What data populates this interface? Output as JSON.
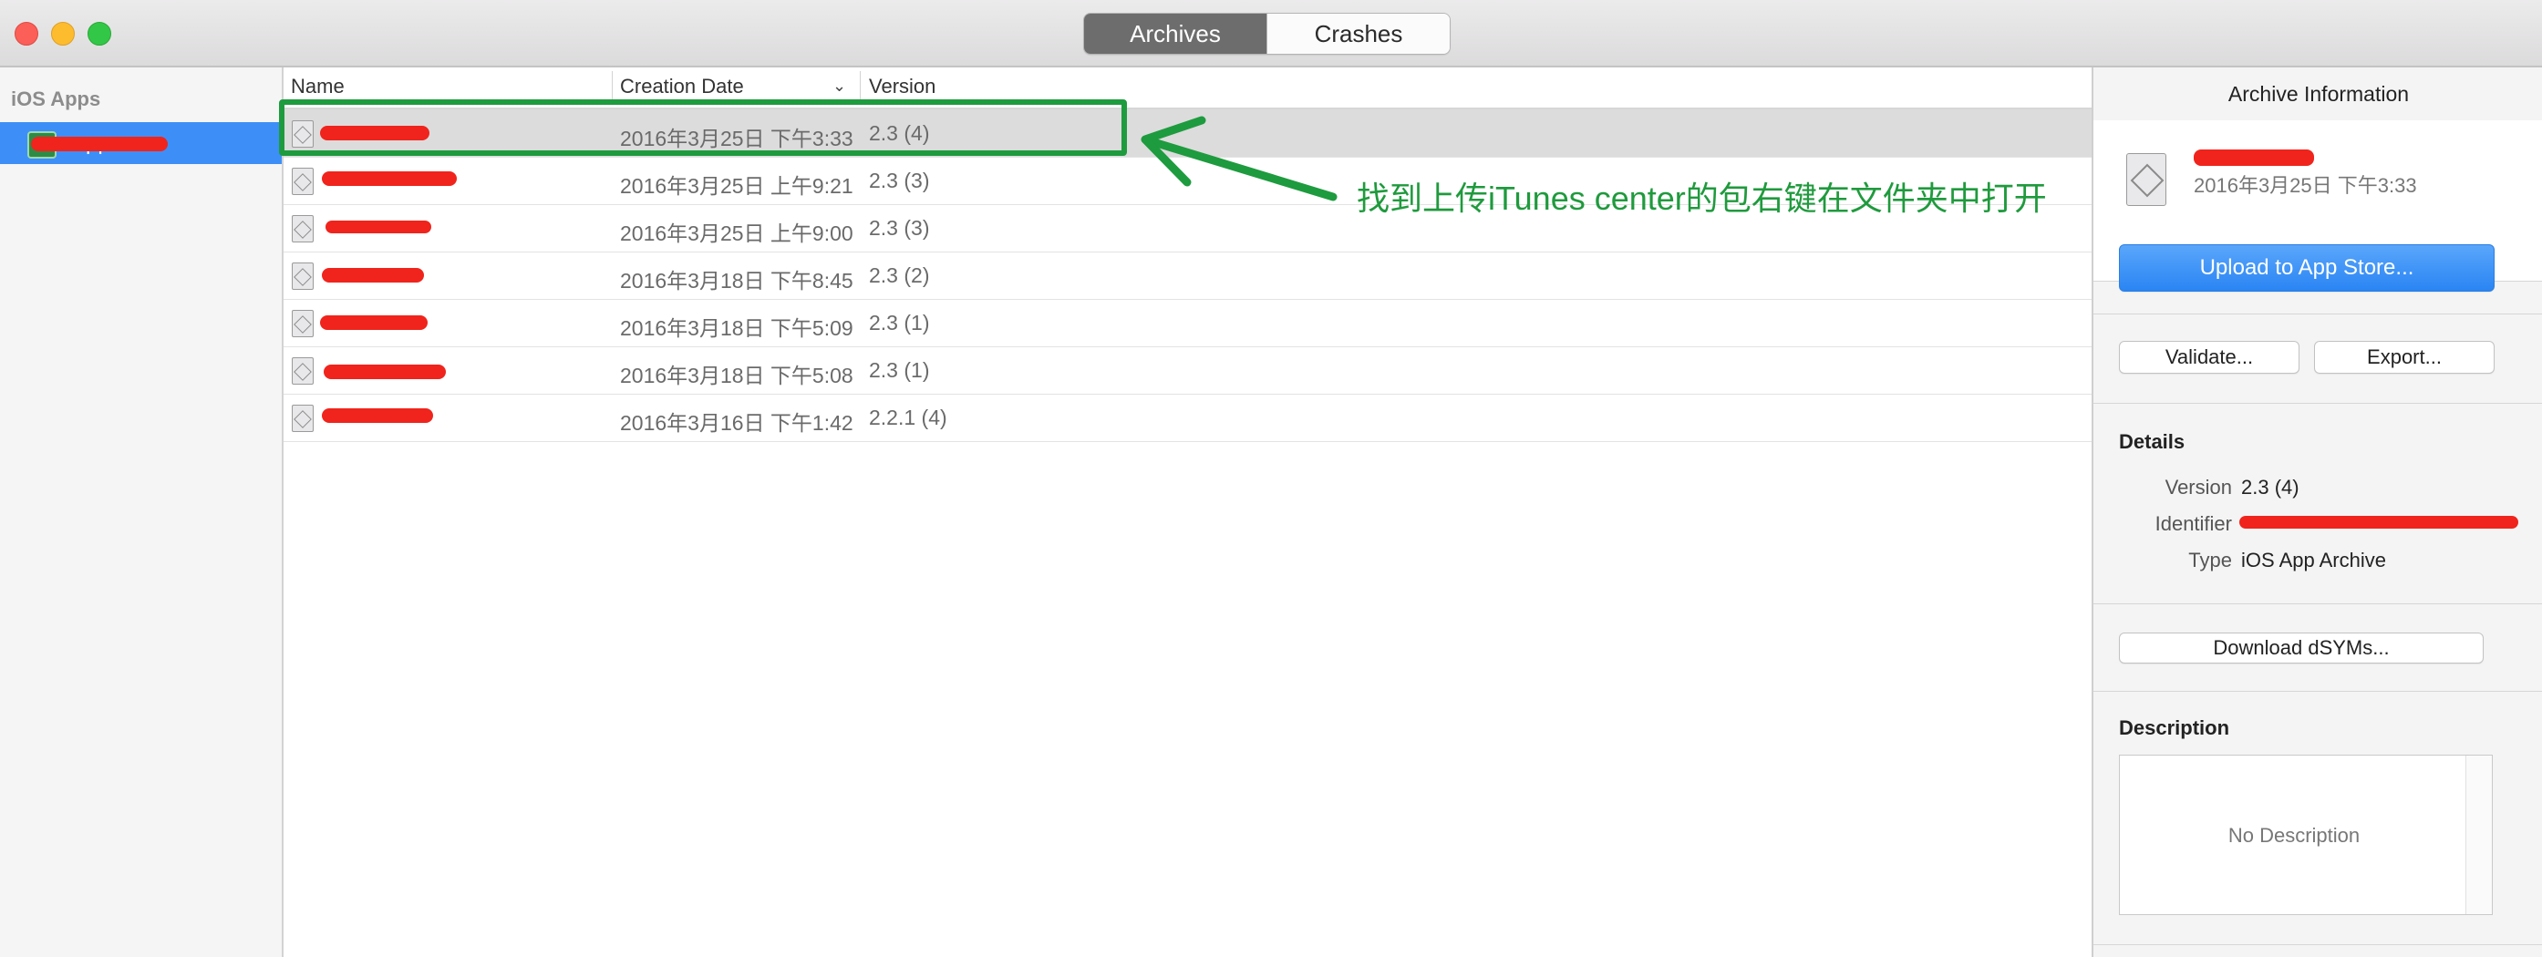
{
  "window": {
    "segments": [
      {
        "label": "Archives",
        "active": true
      },
      {
        "label": "Crashes",
        "active": false
      }
    ]
  },
  "sidebar": {
    "header": "iOS Apps",
    "items": [
      {
        "label": ".app",
        "selected": true
      }
    ]
  },
  "list": {
    "columns": {
      "name": "Name",
      "date": "Creation Date",
      "version": "Version"
    },
    "rows": [
      {
        "date": "2016年3月25日 下午3:33",
        "version": "2.3 (4)",
        "selected": true
      },
      {
        "date": "2016年3月25日 上午9:21",
        "version": "2.3 (3)"
      },
      {
        "date": "2016年3月25日 上午9:00",
        "version": "2.3 (3)"
      },
      {
        "date": "2016年3月18日 下午8:45",
        "version": "2.3 (2)"
      },
      {
        "date": "2016年3月18日 下午5:09",
        "version": "2.3 (1)"
      },
      {
        "date": "2016年3月18日 下午5:08",
        "version": "2.3 (1)"
      },
      {
        "date": "2016年3月16日 下午1:42",
        "version": "2.2.1 (4)"
      }
    ]
  },
  "annotation": {
    "text": "找到上传iTunes center的包右键在文件夹中打开",
    "color": "#1e9b3e"
  },
  "inspector": {
    "title": "Archive Information",
    "archive_date": "2016年3月25日 下午3:33",
    "upload_button": "Upload to App Store...",
    "validate_button": "Validate...",
    "export_button": "Export...",
    "details": {
      "title": "Details",
      "version_key": "Version",
      "version_value": "2.3 (4)",
      "identifier_key": "Identifier",
      "type_key": "Type",
      "type_value": "iOS App Archive"
    },
    "download_button": "Download dSYMs...",
    "description": {
      "title": "Description",
      "placeholder": "No Description"
    }
  },
  "colors": {
    "selection": "#3d8ff7",
    "primary_button": "#2a85f3",
    "redaction": "#f0241c"
  }
}
